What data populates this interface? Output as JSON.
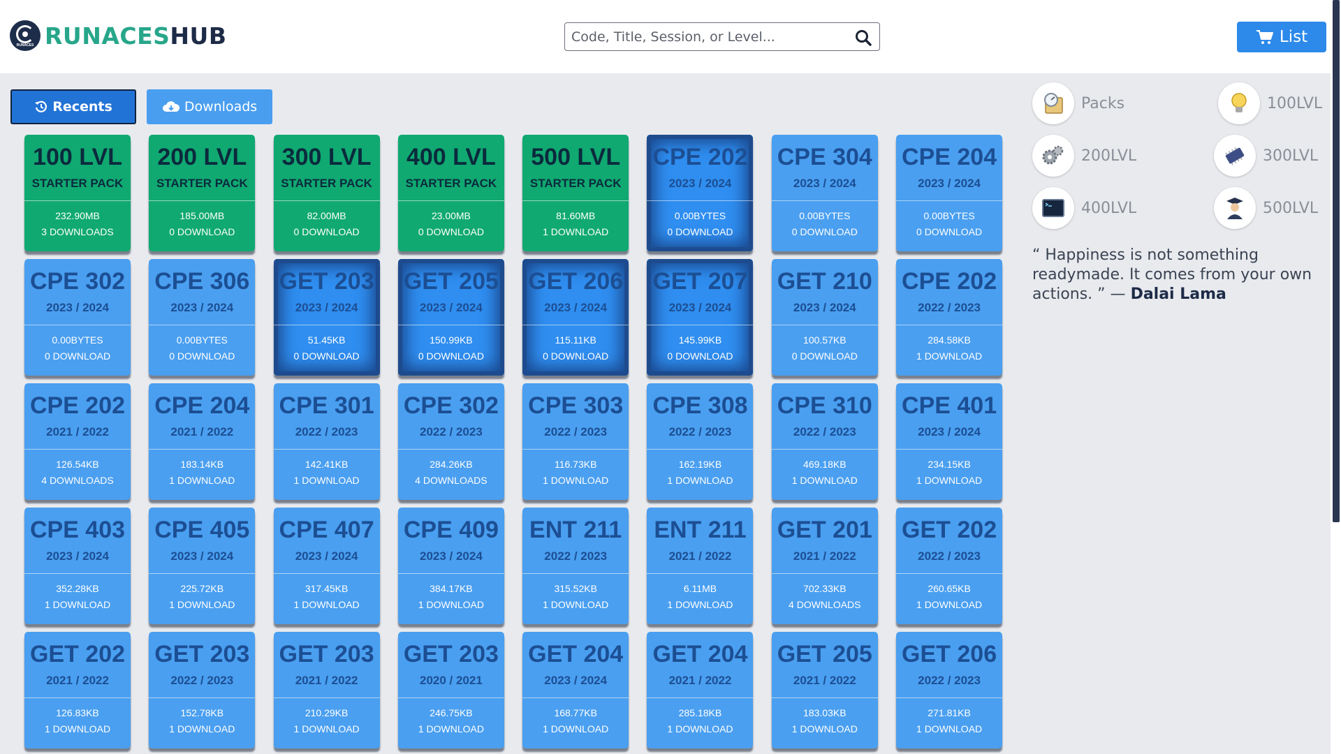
{
  "brand": {
    "part1": "RUNACES",
    "part2": "HUB",
    "mark_text": "RUNACES"
  },
  "search": {
    "placeholder": "Code, Title, Session, or Level..."
  },
  "list_button": {
    "label": "List"
  },
  "tabs": [
    {
      "label": "Recents",
      "active": true
    },
    {
      "label": "Downloads",
      "active": false
    }
  ],
  "cards": [
    {
      "code": "100 LVL",
      "sub": "STARTER PACK",
      "size": "232.90MB",
      "downloads": "3 DOWNLOADS",
      "style": "green"
    },
    {
      "code": "200 LVL",
      "sub": "STARTER PACK",
      "size": "185.00MB",
      "downloads": "0 DOWNLOAD",
      "style": "green"
    },
    {
      "code": "300 LVL",
      "sub": "STARTER PACK",
      "size": "82.00MB",
      "downloads": "0 DOWNLOAD",
      "style": "green"
    },
    {
      "code": "400 LVL",
      "sub": "STARTER PACK",
      "size": "23.00MB",
      "downloads": "0 DOWNLOAD",
      "style": "green"
    },
    {
      "code": "500 LVL",
      "sub": "STARTER PACK",
      "size": "81.60MB",
      "downloads": "1 DOWNLOAD",
      "style": "green"
    },
    {
      "code": "CPE 202",
      "sub": "2023 / 2024",
      "size": "0.00BYTES",
      "downloads": "0 DOWNLOAD",
      "style": "dark"
    },
    {
      "code": "CPE 304",
      "sub": "2023 / 2024",
      "size": "0.00BYTES",
      "downloads": "0 DOWNLOAD",
      "style": "blue"
    },
    {
      "code": "CPE 204",
      "sub": "2023 / 2024",
      "size": "0.00BYTES",
      "downloads": "0 DOWNLOAD",
      "style": "blue"
    },
    {
      "code": "CPE 302",
      "sub": "2023 / 2024",
      "size": "0.00BYTES",
      "downloads": "0 DOWNLOAD",
      "style": "blue"
    },
    {
      "code": "CPE 306",
      "sub": "2023 / 2024",
      "size": "0.00BYTES",
      "downloads": "0 DOWNLOAD",
      "style": "blue"
    },
    {
      "code": "GET 203",
      "sub": "2023 / 2024",
      "size": "51.45KB",
      "downloads": "0 DOWNLOAD",
      "style": "dark"
    },
    {
      "code": "GET 205",
      "sub": "2023 / 2024",
      "size": "150.99KB",
      "downloads": "0 DOWNLOAD",
      "style": "dark"
    },
    {
      "code": "GET 206",
      "sub": "2023 / 2024",
      "size": "115.11KB",
      "downloads": "0 DOWNLOAD",
      "style": "dark"
    },
    {
      "code": "GET 207",
      "sub": "2023 / 2024",
      "size": "145.99KB",
      "downloads": "0 DOWNLOAD",
      "style": "dark"
    },
    {
      "code": "GET 210",
      "sub": "2023 / 2024",
      "size": "100.57KB",
      "downloads": "0 DOWNLOAD",
      "style": "blue"
    },
    {
      "code": "CPE 202",
      "sub": "2022 / 2023",
      "size": "284.58KB",
      "downloads": "1 DOWNLOAD",
      "style": "blue"
    },
    {
      "code": "CPE 202",
      "sub": "2021 / 2022",
      "size": "126.54KB",
      "downloads": "4 DOWNLOADS",
      "style": "blue"
    },
    {
      "code": "CPE 204",
      "sub": "2021 / 2022",
      "size": "183.14KB",
      "downloads": "1 DOWNLOAD",
      "style": "blue"
    },
    {
      "code": "CPE 301",
      "sub": "2022 / 2023",
      "size": "142.41KB",
      "downloads": "1 DOWNLOAD",
      "style": "blue"
    },
    {
      "code": "CPE 302",
      "sub": "2022 / 2023",
      "size": "284.26KB",
      "downloads": "4 DOWNLOADS",
      "style": "blue"
    },
    {
      "code": "CPE 303",
      "sub": "2022 / 2023",
      "size": "116.73KB",
      "downloads": "1 DOWNLOAD",
      "style": "blue"
    },
    {
      "code": "CPE 308",
      "sub": "2022 / 2023",
      "size": "162.19KB",
      "downloads": "1 DOWNLOAD",
      "style": "blue"
    },
    {
      "code": "CPE 310",
      "sub": "2022 / 2023",
      "size": "469.18KB",
      "downloads": "1 DOWNLOAD",
      "style": "blue"
    },
    {
      "code": "CPE 401",
      "sub": "2023 / 2024",
      "size": "234.15KB",
      "downloads": "1 DOWNLOAD",
      "style": "blue"
    },
    {
      "code": "CPE 403",
      "sub": "2023 / 2024",
      "size": "352.28KB",
      "downloads": "1 DOWNLOAD",
      "style": "blue"
    },
    {
      "code": "CPE 405",
      "sub": "2023 / 2024",
      "size": "225.72KB",
      "downloads": "1 DOWNLOAD",
      "style": "blue"
    },
    {
      "code": "CPE 407",
      "sub": "2023 / 2024",
      "size": "317.45KB",
      "downloads": "1 DOWNLOAD",
      "style": "blue"
    },
    {
      "code": "CPE 409",
      "sub": "2023 / 2024",
      "size": "384.17KB",
      "downloads": "1 DOWNLOAD",
      "style": "blue"
    },
    {
      "code": "ENT 211",
      "sub": "2022 / 2023",
      "size": "315.52KB",
      "downloads": "1 DOWNLOAD",
      "style": "blue"
    },
    {
      "code": "ENT 211",
      "sub": "2021 / 2022",
      "size": "6.11MB",
      "downloads": "1 DOWNLOAD",
      "style": "blue"
    },
    {
      "code": "GET 201",
      "sub": "2021 / 2022",
      "size": "702.33KB",
      "downloads": "4 DOWNLOADS",
      "style": "blue"
    },
    {
      "code": "GET 202",
      "sub": "2022 / 2023",
      "size": "260.65KB",
      "downloads": "1 DOWNLOAD",
      "style": "blue"
    },
    {
      "code": "GET 202",
      "sub": "2021 / 2022",
      "size": "126.83KB",
      "downloads": "1 DOWNLOAD",
      "style": "blue"
    },
    {
      "code": "GET 203",
      "sub": "2022 / 2023",
      "size": "152.78KB",
      "downloads": "1 DOWNLOAD",
      "style": "blue"
    },
    {
      "code": "GET 203",
      "sub": "2021 / 2022",
      "size": "210.29KB",
      "downloads": "1 DOWNLOAD",
      "style": "blue"
    },
    {
      "code": "GET 203",
      "sub": "2020 / 2021",
      "size": "246.75KB",
      "downloads": "1 DOWNLOAD",
      "style": "blue"
    },
    {
      "code": "GET 204",
      "sub": "2023 / 2024",
      "size": "168.77KB",
      "downloads": "1 DOWNLOAD",
      "style": "blue"
    },
    {
      "code": "GET 204",
      "sub": "2021 / 2022",
      "size": "285.18KB",
      "downloads": "1 DOWNLOAD",
      "style": "blue"
    },
    {
      "code": "GET 205",
      "sub": "2021 / 2022",
      "size": "183.03KB",
      "downloads": "1 DOWNLOAD",
      "style": "blue"
    },
    {
      "code": "GET 206",
      "sub": "2022 / 2023",
      "size": "271.81KB",
      "downloads": "1 DOWNLOAD",
      "style": "blue"
    }
  ],
  "sidebar": {
    "levels": [
      {
        "label": "Packs",
        "icon": "packs-icon"
      },
      {
        "label": "100LVL",
        "icon": "lightbulb-icon"
      },
      {
        "label": "200LVL",
        "icon": "gears-icon"
      },
      {
        "label": "300LVL",
        "icon": "chip-icon"
      },
      {
        "label": "400LVL",
        "icon": "terminal-icon"
      },
      {
        "label": "500LVL",
        "icon": "graduate-icon"
      }
    ],
    "quote": {
      "text": "“ Happiness is not something readymade. It comes from your own actions. ” — ",
      "author": "Dalai Lama"
    }
  },
  "colors": {
    "green_card": "#10a971",
    "blue_card": "#4a9ff0",
    "brand_green": "#27a68a",
    "brand_navy": "#1d2b47",
    "accent_blue": "#2d89ea"
  }
}
